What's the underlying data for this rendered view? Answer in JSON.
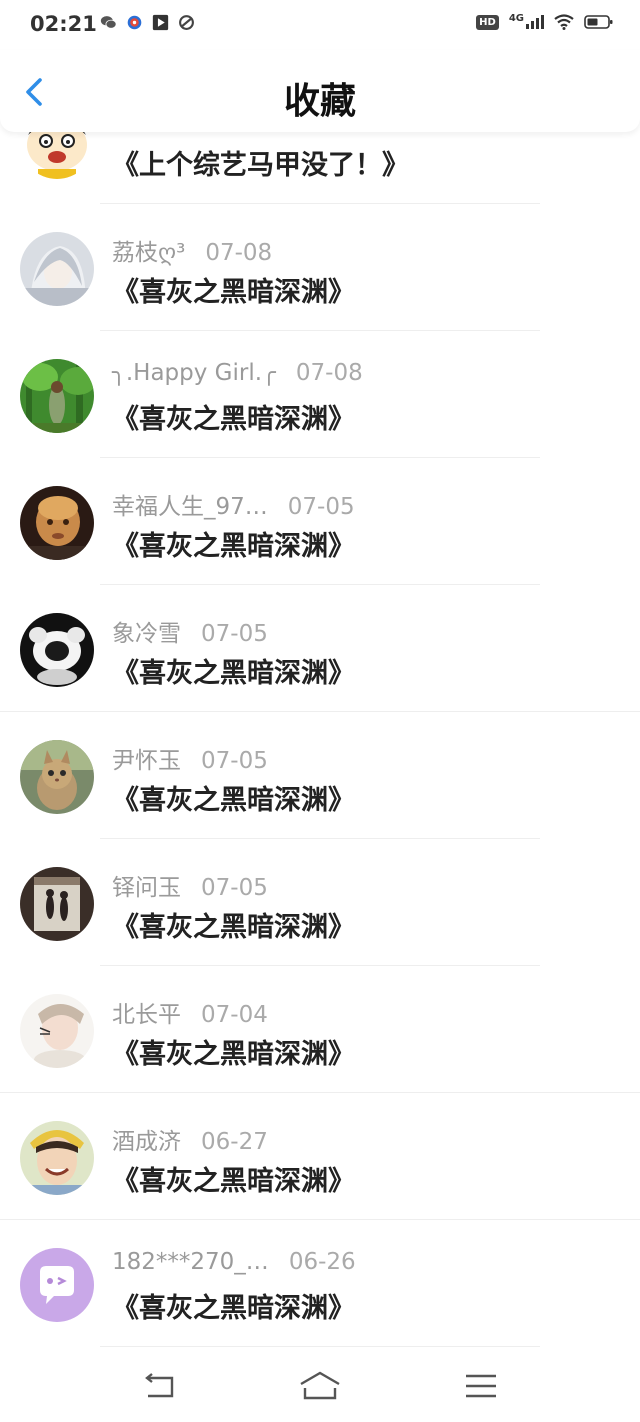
{
  "status_bar": {
    "time": "02:21",
    "hd": "HD",
    "network": "4G",
    "left_icons": [
      "wechat-icon",
      "app-icon-red",
      "video-app-icon",
      "browser-app-icon"
    ],
    "right_icons": [
      "hd-icon",
      "signal-icon",
      "wifi-icon",
      "battery-icon"
    ]
  },
  "header": {
    "title": "收藏",
    "back_icon": "chevron-left-icon",
    "accent": "#2f8ee8"
  },
  "favorites": [
    {
      "user": "",
      "date": "",
      "title": "《上个综艺马甲没了！》",
      "avatar": "cartoon-avatar"
    },
    {
      "user": "荔枝ღ³",
      "date": "07-08",
      "title": "《喜灰之黑暗深渊》",
      "avatar": "anime-girl-avatar"
    },
    {
      "user": "╮.Happy Girl.╭",
      "date": "07-08",
      "title": "《喜灰之黑暗深渊》",
      "avatar": "forest-avatar"
    },
    {
      "user": "幸福人生_97…",
      "date": "07-05",
      "title": "《喜灰之黑暗深渊》",
      "avatar": "doll-avatar"
    },
    {
      "user": "象冷雪",
      "date": "07-05",
      "title": "《喜灰之黑暗深渊》",
      "avatar": "panda-avatar"
    },
    {
      "user": "尹怀玉",
      "date": "07-05",
      "title": "《喜灰之黑暗深渊》",
      "avatar": "cat-avatar"
    },
    {
      "user": "铎问玉",
      "date": "07-05",
      "title": "《喜灰之黑暗深渊》",
      "avatar": "dancers-avatar"
    },
    {
      "user": "北长平",
      "date": "07-04",
      "title": "《喜灰之黑暗深渊》",
      "avatar": "girl-avatar"
    },
    {
      "user": "酒成济",
      "date": "06-27",
      "title": "《喜灰之黑暗深渊》",
      "avatar": "smiling-boy-avatar"
    },
    {
      "user": "182***270_…",
      "date": "06-26",
      "title": "《喜灰之黑暗深渊》",
      "avatar": "default-chat-avatar"
    }
  ],
  "bottom_nav": {
    "icons": [
      "back-nav-icon",
      "home-nav-icon",
      "menu-nav-icon"
    ]
  }
}
